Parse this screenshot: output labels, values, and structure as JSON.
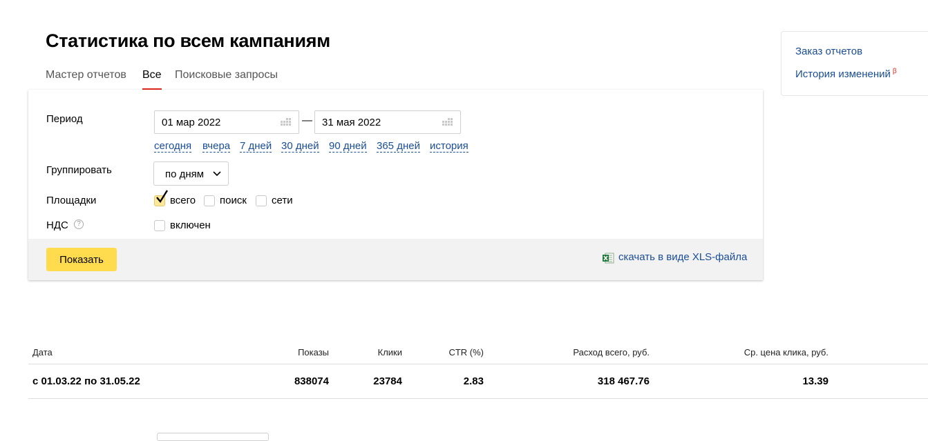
{
  "page": {
    "title": "Статистика по всем кампаниям"
  },
  "tabs": [
    {
      "label": "Мастер отчетов",
      "active": false
    },
    {
      "label": "Все",
      "active": true
    },
    {
      "label": "Поисковые запросы",
      "active": false
    }
  ],
  "side_links": {
    "order_reports": "Заказ отчетов",
    "change_history": "История изменений",
    "beta_mark": "β"
  },
  "form": {
    "period_label": "Период",
    "date_from": "01 мар 2022",
    "date_separator": "—",
    "date_to": "31 мая 2022",
    "quick_periods": [
      "сегодня",
      "вчера",
      "7 дней",
      "30 дней",
      "90 дней",
      "365 дней",
      "история"
    ],
    "group_label": "Группировать",
    "group_value": "по дням",
    "platforms_label": "Площадки",
    "platforms": [
      {
        "label": "всего",
        "checked": true
      },
      {
        "label": "поиск",
        "checked": false
      },
      {
        "label": "сети",
        "checked": false
      }
    ],
    "vat_label": "НДС",
    "vat_help": "?",
    "vat_option": {
      "label": "включен",
      "checked": false
    },
    "show_button": "Показать",
    "xls_link": "скачать в виде XLS-файла"
  },
  "table": {
    "headers": {
      "date": "Дата",
      "impressions": "Показы",
      "clicks": "Клики",
      "ctr": "CTR (%)",
      "spend": "Расход всего, руб.",
      "cpc": "Ср. цена клика, руб."
    },
    "rows": [
      {
        "date": "с 01.03.22 по 31.05.22",
        "impressions": "838074",
        "clicks": "23784",
        "ctr": "2.83",
        "spend": "318 467.76",
        "cpc": "13.39"
      }
    ]
  },
  "colors": {
    "link": "#1a4d96",
    "active_tab_underline": "#e0251b",
    "primary_button": "#ffdb4d",
    "footer_bg": "#f2f2f2"
  },
  "icons": {
    "calendar": "calendar-icon",
    "chevron": "chevron-down-icon",
    "excel": "excel-icon",
    "help": "help-icon",
    "check": "checkmark-icon"
  }
}
